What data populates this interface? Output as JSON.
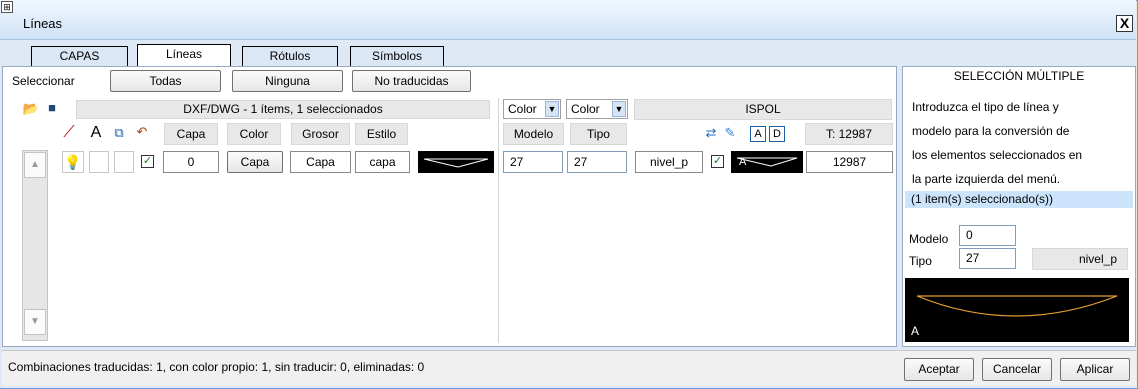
{
  "window": {
    "title": "Líneas",
    "close_label": "X",
    "pin_label": "⊞"
  },
  "tabs": [
    {
      "label": "CAPAS"
    },
    {
      "label": "Líneas"
    },
    {
      "label": "Rótulos"
    },
    {
      "label": "Símbolos"
    }
  ],
  "select_bar": {
    "label": "Seleccionar",
    "all": "Todas",
    "none": "Ninguna",
    "untranslated": "No traducidas"
  },
  "dxf": {
    "summary": "DXF/DWG - 1 ítems, 1 seleccionados",
    "headers": [
      "Capa",
      "Color",
      "Grosor",
      "Estilo"
    ]
  },
  "ispol": {
    "color_select_1": "Color",
    "color_select_2": "Color",
    "title": "ISPOL",
    "headers": {
      "model": "Modelo",
      "type": "Tipo",
      "total": "T: 12987"
    },
    "a_label": "A",
    "d_label": "D"
  },
  "row": {
    "layer": "0",
    "color": "Capa",
    "weight": "Capa",
    "style": "capa",
    "model": "27",
    "type": "27",
    "level": "nivel_p",
    "preview_label": "A",
    "count": "12987"
  },
  "right_panel": {
    "title": "SELECCIÓN MÚLTIPLE",
    "lines": [
      "Introduzca el tipo de línea y",
      "modelo para la conversión de",
      "los elementos seleccionados en",
      "la parte izquierda del menú."
    ],
    "selected": "(1 item(s) seleccionado(s))",
    "model_label": "Modelo",
    "model_value": "0",
    "type_label": "Tipo",
    "type_value": "27",
    "level_button": "nivel_p",
    "preview_label": "A"
  },
  "status": {
    "text": "Combinaciones traducidas: 1, con color propio: 1, sin traducir: 0, eliminadas: 0",
    "accept": "Aceptar",
    "cancel": "Cancelar",
    "apply": "Aplicar"
  },
  "colors": {
    "accent": "#cce4fb",
    "line_preview_bg": "#000000",
    "line_preview_stroke": "#e8a030"
  }
}
